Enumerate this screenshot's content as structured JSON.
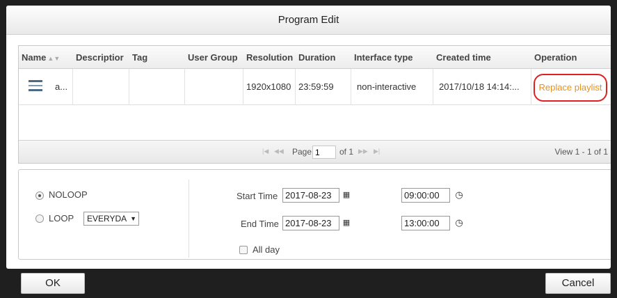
{
  "dialog": {
    "title": "Program Edit"
  },
  "grid": {
    "columns": [
      "Name",
      "Descriptior",
      "Tag",
      "User Group",
      "Resolution",
      "Duration",
      "Interface type",
      "Created time",
      "Operation"
    ],
    "rows": [
      {
        "name": "a...",
        "description": "",
        "tag": "",
        "user_group": "",
        "resolution": "1920x1080",
        "duration": "23:59:59",
        "interface_type": "non-interactive",
        "created_time": "2017/10/18 14:14:...",
        "operation": "Replace playlist"
      }
    ],
    "pager": {
      "page_label": "Page",
      "page_value": "1",
      "of_label": "of 1",
      "view_text": "View 1 - 1 of 1"
    }
  },
  "schedule": {
    "noloop_label": "NOLOOP",
    "loop_label": "LOOP",
    "loop_select_value": "EVERYDA",
    "selected_mode": "NOLOOP",
    "start_time_label": "Start Time",
    "start_date": "2017-08-23",
    "start_time": "09:00:00",
    "end_time_label": "End Time",
    "end_date": "2017-08-23",
    "end_time": "13:00:00",
    "all_day_label": "All day",
    "all_day_checked": false
  },
  "footer": {
    "ok_label": "OK",
    "cancel_label": "Cancel"
  },
  "colors": {
    "accent_link": "#e9901a",
    "highlight_circle": "#e02020",
    "backdrop": "#1f1f1f"
  },
  "icons": [
    "program-list-icon",
    "sort-icon",
    "first-page-icon",
    "prev-page-icon",
    "next-page-icon",
    "last-page-icon",
    "calendar-icon",
    "clock-icon",
    "dropdown-arrow-icon"
  ]
}
